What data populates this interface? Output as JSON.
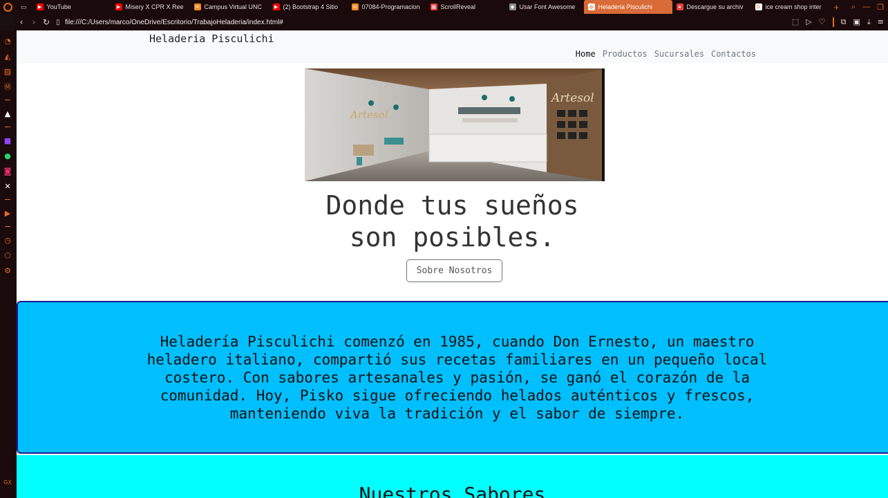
{
  "browser": {
    "tabs": [
      {
        "label": "YouTube",
        "color": "#ff0000",
        "glyph": "▶"
      },
      {
        "label": "Misery X CPR X Ree",
        "color": "#ff0000",
        "glyph": "▶"
      },
      {
        "label": "Campus Virtual UNC",
        "color": "#f08a24",
        "glyph": "m"
      },
      {
        "label": "(2) Bootstrap 4 Sitio",
        "color": "#ff0000",
        "glyph": "▶"
      },
      {
        "label": "07084-Programacion",
        "color": "#f08a24",
        "glyph": "m"
      },
      {
        "label": "ScrollReveal",
        "color": "#e9403c",
        "glyph": "▦"
      },
      {
        "label": "Usar Font Awesome",
        "color": "#888888",
        "glyph": "◉"
      },
      {
        "label": "Heladeria Pisculichi",
        "color": "#ffffff",
        "glyph": "◍",
        "active": true
      },
      {
        "label": "Descargue su archiv",
        "color": "#e9403c",
        "glyph": "●"
      },
      {
        "label": "ice cream shop inter",
        "color": "#ffffff",
        "glyph": "G"
      }
    ],
    "url": "file:///C:/Users/marco/OneDrive/Escritorio/TrabajoHeladeria/index.html#"
  },
  "navbar": {
    "brand": "Heladeria Pisculichi",
    "links": [
      "Home",
      "Productos",
      "Sucursales",
      "Contactos"
    ],
    "active_index": 0
  },
  "hero": {
    "sign_text": "Artesol",
    "title_line1": "Donde tus sueños",
    "title_line2": "son posibles.",
    "button_label": "Sobre Nosotros"
  },
  "about": {
    "text": "Heladería Pisculichi comenzó en 1985, cuando Don Ernesto, un maestro heladero italiano, compartió sus recetas familiares en un pequeño local costero. Con sabores artesanales y pasión, se ganó el corazón de la comunidad. Hoy, Pisko sigue ofreciendo helados auténticos y frescos, manteniendo viva la tradición y el sabor de siempre.",
    "background": "#00bfff",
    "border": "#1b1b8f"
  },
  "flavors": {
    "title": "Nuestros Sabores",
    "background": "#00ffff"
  },
  "colors": {
    "opera_accent": "#e36b2b",
    "chrome_bg": "#1b0a0b"
  }
}
